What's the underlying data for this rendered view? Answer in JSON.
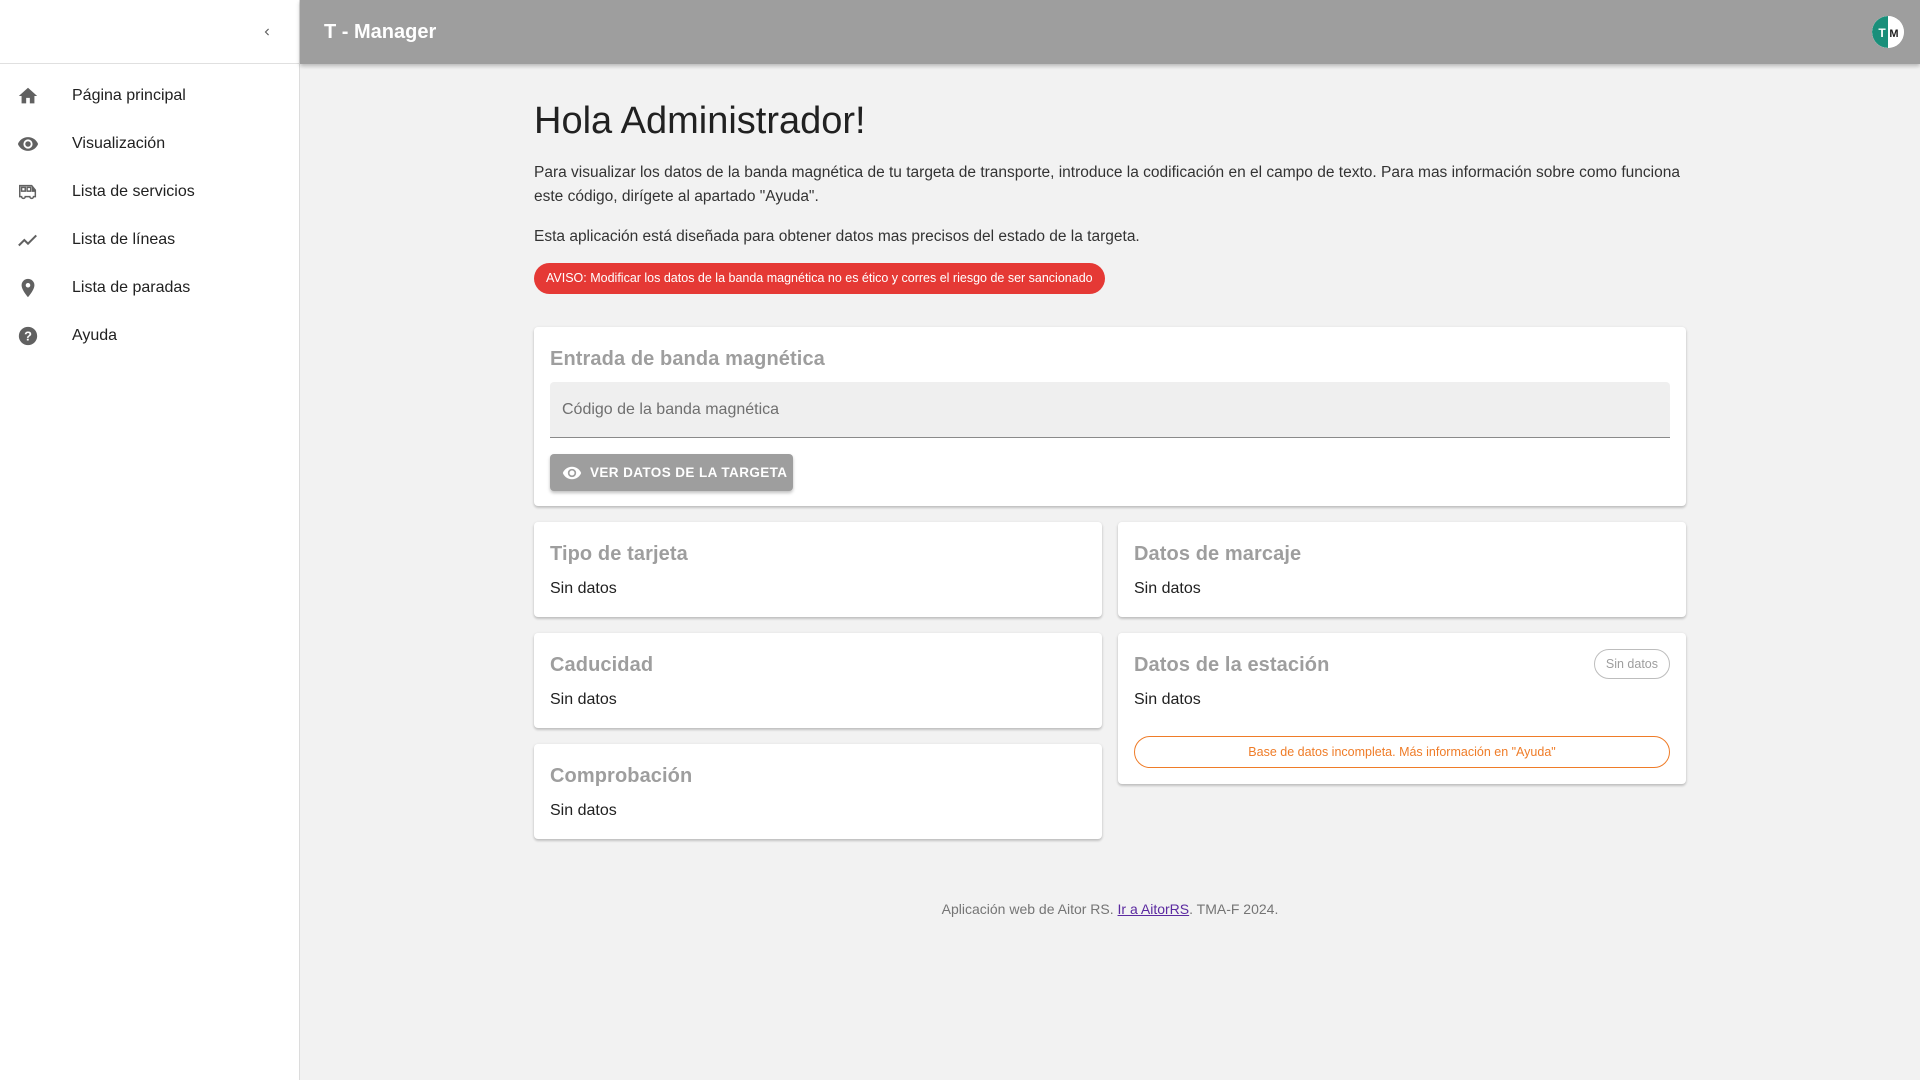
{
  "header": {
    "title": "T - Manager",
    "avatar_letters": "TM"
  },
  "sidebar": {
    "items": [
      {
        "label": "Página principal",
        "icon": "home-icon"
      },
      {
        "label": "Visualización",
        "icon": "eye-icon"
      },
      {
        "label": "Lista de servicios",
        "icon": "bus-icon"
      },
      {
        "label": "Lista de líneas",
        "icon": "trending-line-icon"
      },
      {
        "label": "Lista de paradas",
        "icon": "map-marker-icon"
      },
      {
        "label": "Ayuda",
        "icon": "help-circle-icon"
      }
    ]
  },
  "main": {
    "greeting": "Hola Administrador!",
    "intro": "Para visualizar los datos de la banda magnética de tu targeta de transporte, introduce la codificación en el campo de texto. Para mas información sobre como funciona este código, dirígete al apartado \"Ayuda\".",
    "intro2": "Esta aplicación está diseñada para obtener datos mas precisos del estado de la targeta.",
    "warning": "AVISO: Modificar los datos de la banda magnética no es ético y corres el riesgo de ser sancionado",
    "input_card": {
      "title": "Entrada de banda magnética",
      "placeholder": "Código de la banda magnética",
      "button_label": "VER DATOS DE LA TARGETA"
    },
    "cards": {
      "tipo": {
        "title": "Tipo de tarjeta",
        "value": "Sin datos"
      },
      "marcaje": {
        "title": "Datos de marcaje",
        "value": "Sin datos"
      },
      "caducidad": {
        "title": "Caducidad",
        "value": "Sin datos"
      },
      "comprobacion": {
        "title": "Comprobación",
        "value": "Sin datos"
      },
      "estacion": {
        "title": "Datos de la estación",
        "value": "Sin datos",
        "chip": "Sin datos",
        "alert": "Base de datos incompleta. Más información en \"Ayuda\""
      }
    }
  },
  "footer": {
    "prefix": "Aplicación web de Aitor RS. ",
    "link": "Ir a AitorRS",
    "suffix": ". TMA-F 2024."
  },
  "colors": {
    "header": "#9e9e9e",
    "warning": "#e53935",
    "alert": "#ef7c28",
    "avatar_teal": "#1a8f7a"
  }
}
